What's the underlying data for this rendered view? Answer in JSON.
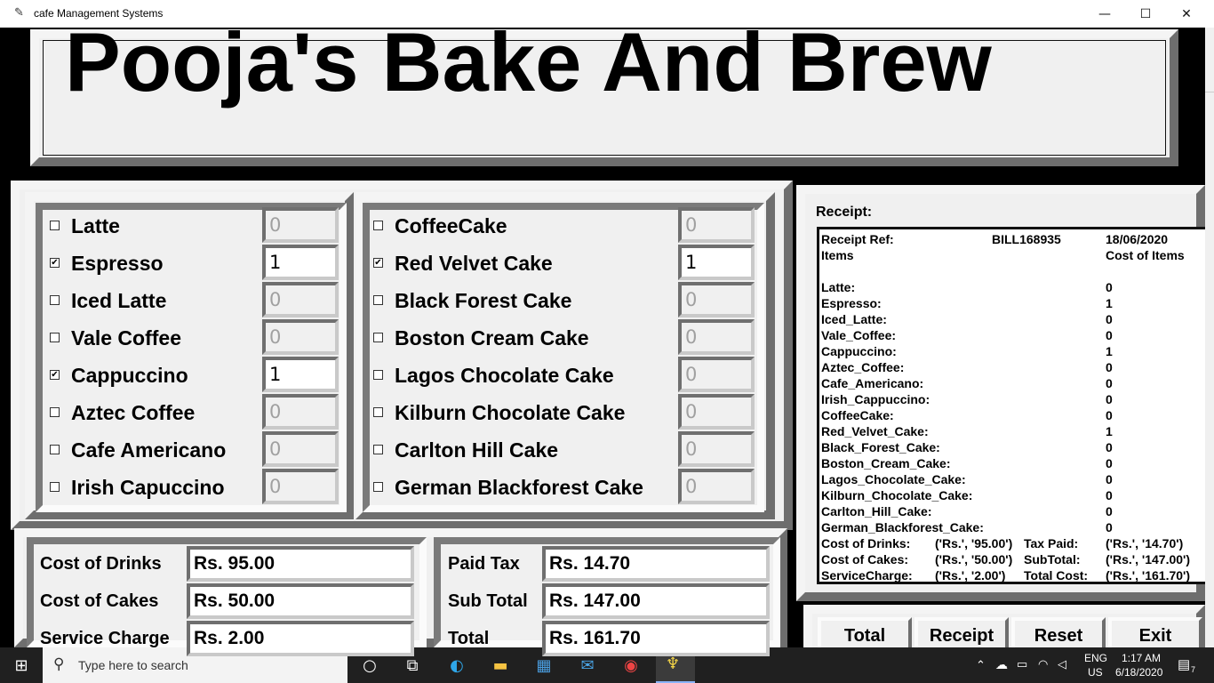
{
  "window": {
    "title": "cafe Management Systems",
    "minimize": "—",
    "maximize": "☐",
    "close": "✕"
  },
  "header": {
    "title": "Pooja's Bake And Brew"
  },
  "drinks": [
    {
      "label": "Latte",
      "checked": false,
      "qty": "0"
    },
    {
      "label": "Espresso",
      "checked": true,
      "qty": "1"
    },
    {
      "label": "Iced Latte",
      "checked": false,
      "qty": "0"
    },
    {
      "label": "Vale Coffee",
      "checked": false,
      "qty": "0"
    },
    {
      "label": "Cappuccino",
      "checked": true,
      "qty": "1"
    },
    {
      "label": "Aztec Coffee",
      "checked": false,
      "qty": "0"
    },
    {
      "label": "Cafe Americano",
      "checked": false,
      "qty": "0"
    },
    {
      "label": "Irish Capuccino",
      "checked": false,
      "qty": "0"
    }
  ],
  "cakes": [
    {
      "label": "CoffeeCake",
      "checked": false,
      "qty": "0"
    },
    {
      "label": "Red Velvet Cake",
      "checked": true,
      "qty": "1"
    },
    {
      "label": "Black Forest Cake",
      "checked": false,
      "qty": "0"
    },
    {
      "label": "Boston Cream Cake",
      "checked": false,
      "qty": "0"
    },
    {
      "label": "Lagos Chocolate Cake",
      "checked": false,
      "qty": "0"
    },
    {
      "label": "Kilburn Chocolate Cake",
      "checked": false,
      "qty": "0"
    },
    {
      "label": "Carlton Hill Cake",
      "checked": false,
      "qty": "0"
    },
    {
      "label": "German Blackforest Cake",
      "checked": false,
      "qty": "0"
    }
  ],
  "costs_left": [
    {
      "label": "Cost of Drinks",
      "value": "Rs. 95.00"
    },
    {
      "label": "Cost of Cakes",
      "value": "Rs. 50.00"
    },
    {
      "label": "Service Charge",
      "value": "Rs. 2.00"
    }
  ],
  "costs_right": [
    {
      "label": "Paid Tax",
      "value": "Rs. 14.70"
    },
    {
      "label": "Sub Total",
      "value": "Rs. 147.00"
    },
    {
      "label": "Total",
      "value": "Rs. 161.70"
    }
  ],
  "receipt": {
    "heading": "Receipt:",
    "ref_label": "Receipt Ref:",
    "ref_value": "BILL168935",
    "date": "18/06/2020",
    "items_label": "Items",
    "cost_label": "Cost of Items",
    "lines": [
      {
        "name": "Latte:",
        "qty": "0"
      },
      {
        "name": "Espresso:",
        "qty": "1"
      },
      {
        "name": "Iced_Latte:",
        "qty": "0"
      },
      {
        "name": "Vale_Coffee:",
        "qty": "0"
      },
      {
        "name": "Cappuccino:",
        "qty": "1"
      },
      {
        "name": "Aztec_Coffee:",
        "qty": "0"
      },
      {
        "name": "Cafe_Americano:",
        "qty": "0"
      },
      {
        "name": "Irish_Cappuccino:",
        "qty": "0"
      },
      {
        "name": "CoffeeCake:",
        "qty": "0"
      },
      {
        "name": "Red_Velvet_Cake:",
        "qty": "1"
      },
      {
        "name": "Black_Forest_Cake:",
        "qty": "0"
      },
      {
        "name": "Boston_Cream_Cake:",
        "qty": "0"
      },
      {
        "name": "Lagos_Chocolate_Cake:",
        "qty": "0"
      },
      {
        "name": "Kilburn_Chocolate_Cake:",
        "qty": "0"
      },
      {
        "name": "Carlton_Hill_Cake:",
        "qty": "0"
      },
      {
        "name": "German_Blackforest_Cake:",
        "qty": "0"
      }
    ],
    "summary": [
      {
        "a": "Cost of Drinks:",
        "b": "('Rs.', '95.00')",
        "c": "Tax Paid:",
        "d": "('Rs.', '14.70')"
      },
      {
        "a": "Cost of Cakes:",
        "b": "('Rs.', '50.00')",
        "c": "SubTotal:",
        "d": "('Rs.', '147.00')"
      },
      {
        "a": "ServiceCharge:",
        "b": "('Rs.', '2.00')",
        "c": "Total Cost:",
        "d": "('Rs.', '161.70')"
      }
    ]
  },
  "buttons": {
    "total": "Total",
    "receipt": "Receipt",
    "reset": "Reset",
    "exit": "Exit"
  },
  "taskbar": {
    "search_placeholder": "Type here to search",
    "lang1": "ENG",
    "lang2": "US",
    "time": "1:17 AM",
    "date": "6/18/2020",
    "notif_count": "7"
  }
}
